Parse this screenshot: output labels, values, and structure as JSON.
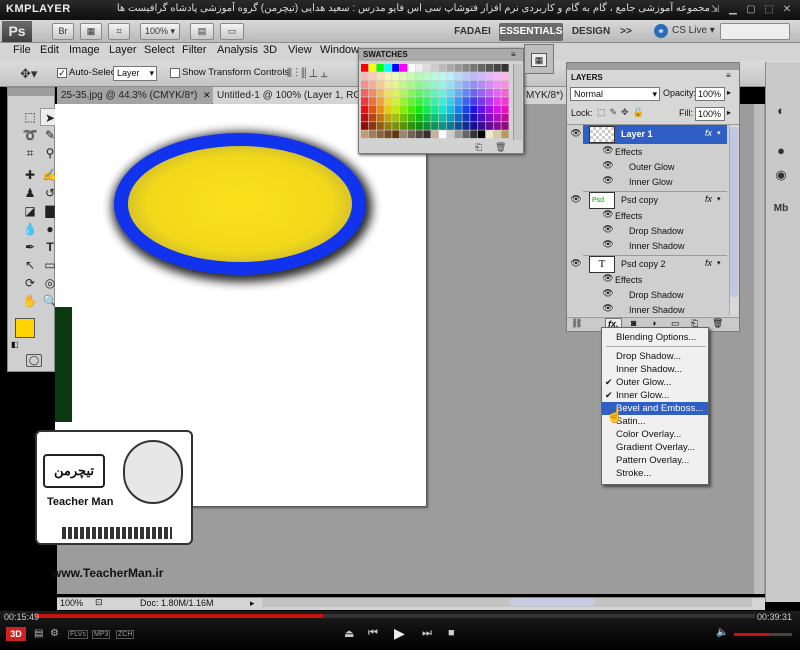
{
  "player": {
    "logo": "KMPLAYER",
    "title": "مجموعه آموزشی جامع ، گام به گام و کاربردی نرم افزار فتوشاپ سی اس فایو  مدرس : سعید هدایی (تیچرمن) گروه آموزشی پادشاه گرافیست ها",
    "time_current": "00:15:49",
    "time_total": "00:39:31",
    "formats": [
      "3D",
      "FLVs",
      "MP3",
      "ZCH"
    ],
    "progress": 0.4,
    "volume": 0.6
  },
  "app": {
    "logo": "Ps",
    "br": "Br",
    "zoom": "100%",
    "workspaces": [
      "FADAEI",
      "ESSENTIALS",
      "DESIGN"
    ],
    "more": ">>",
    "cslive": "CS Live"
  },
  "menu": [
    "File",
    "Edit",
    "Image",
    "Layer",
    "Select",
    "Filter",
    "Analysis",
    "3D",
    "View",
    "Window"
  ],
  "options": {
    "auto_select_label": "Auto-Select:",
    "auto_select_value": "Layer",
    "show_transform": "Show Transform Controls"
  },
  "tabs": [
    "25-35.jpg @ 44.3% (CMYK/8*)",
    "Untitled-1 @ 100% (Layer 1, RG",
    "MYK/8*)"
  ],
  "swatches": {
    "title": "SWATCHES"
  },
  "layers": {
    "title": "LAYERS",
    "blend": "Normal",
    "opacity_label": "Opacity:",
    "opacity": "100%",
    "lock_label": "Lock:",
    "fill_label": "Fill:",
    "fill": "100%",
    "items": [
      {
        "name": "Layer 1",
        "selected": true,
        "fx": "fx",
        "effects_label": "Effects",
        "effects": [
          "Outer Glow",
          "Inner Glow"
        ]
      },
      {
        "name": "Psd copy",
        "selected": false,
        "fx": "fx",
        "effects_label": "Effects",
        "effects": [
          "Drop Shadow",
          "Inner Shadow"
        ]
      },
      {
        "name": "Psd copy 2",
        "selected": false,
        "fx": "fx",
        "effects_label": "Effects",
        "effects": [
          "Drop Shadow",
          "Inner Shadow"
        ]
      }
    ]
  },
  "fxmenu": {
    "items": [
      "Blending Options...",
      "Drop Shadow...",
      "Inner Shadow...",
      "Outer Glow...",
      "Inner Glow...",
      "Bevel and Emboss...",
      "Satin...",
      "Color Overlay...",
      "Gradient Overlay...",
      "Pattern Overlay...",
      "Stroke..."
    ],
    "checked": [
      "Outer Glow...",
      "Inner Glow..."
    ],
    "highlighted": "Bevel and Emboss..."
  },
  "status": {
    "zoom": "100%",
    "doc": "Doc: 1.80M/1.16M"
  },
  "watermark": {
    "site": "www.TeacherMan.ir",
    "brand": "Teacher Man"
  },
  "colors": {
    "ellipse_outer": "#1133ee",
    "ellipse_inner": "#f7e01a",
    "foreground": "#ffd400",
    "selection": "#2f5fc4"
  }
}
